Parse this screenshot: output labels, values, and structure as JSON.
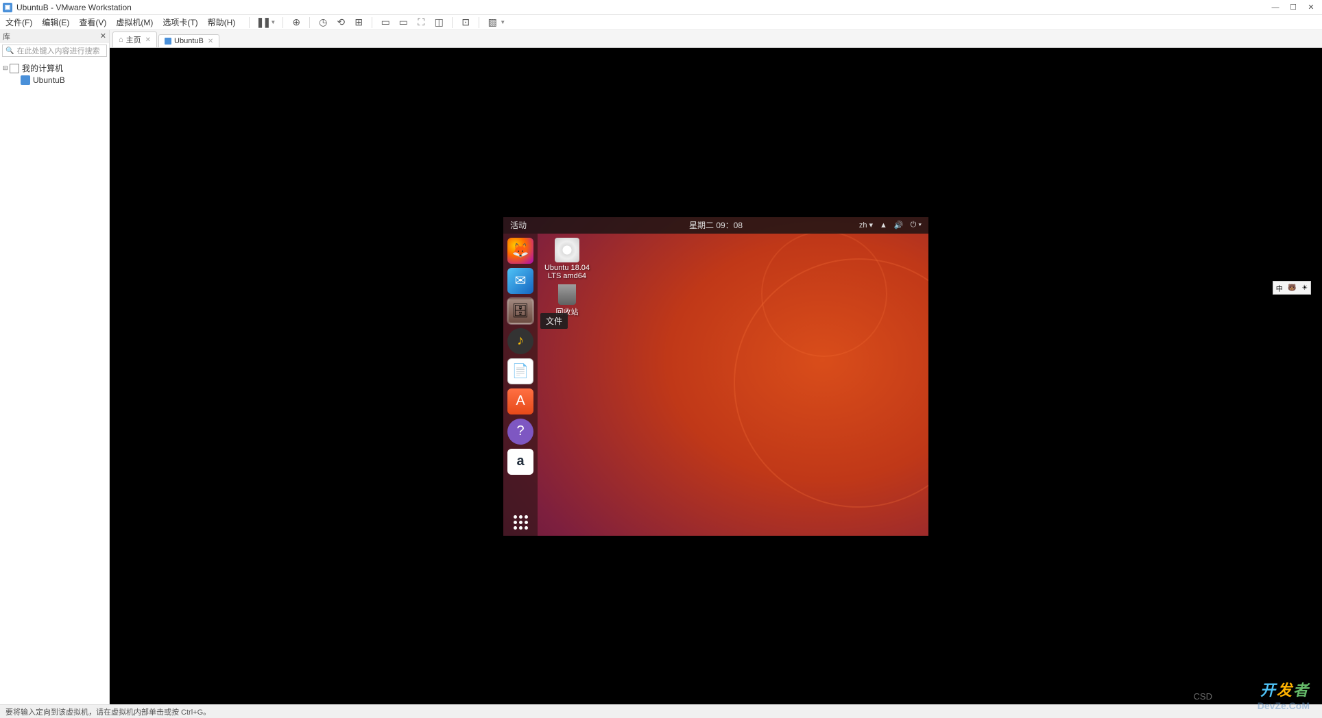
{
  "window": {
    "title": "UbuntuB - VMware Workstation",
    "min": "—",
    "max": "☐",
    "close": "✕"
  },
  "menubar": {
    "items": [
      "文件(F)",
      "编辑(E)",
      "查看(V)",
      "虚拟机(M)",
      "选项卡(T)",
      "帮助(H)"
    ]
  },
  "sidebar": {
    "title": "库",
    "search_placeholder": "在此处键入内容进行搜索",
    "root": "我的计算机",
    "vm": "UbuntuB"
  },
  "tabs": {
    "home": "主页",
    "vm": "UbuntuB"
  },
  "ubuntu": {
    "activities": "活动",
    "clock": "星期二 09：08",
    "input_method": "zh",
    "desktop_dvd_label": "Ubuntu 18.04 LTS amd64",
    "desktop_trash_label": "回收站",
    "files_tooltip": "文件",
    "amazon_letter": "a"
  },
  "input_panel": {
    "lang": "中"
  },
  "statusbar": {
    "text": "要将输入定向到该虚拟机，请在虚拟机内部单击或按 Ctrl+G。"
  },
  "watermarks": {
    "brand_prefix": "开发者",
    "csdn": "CSD",
    "devze": "DevZe.CoM"
  }
}
